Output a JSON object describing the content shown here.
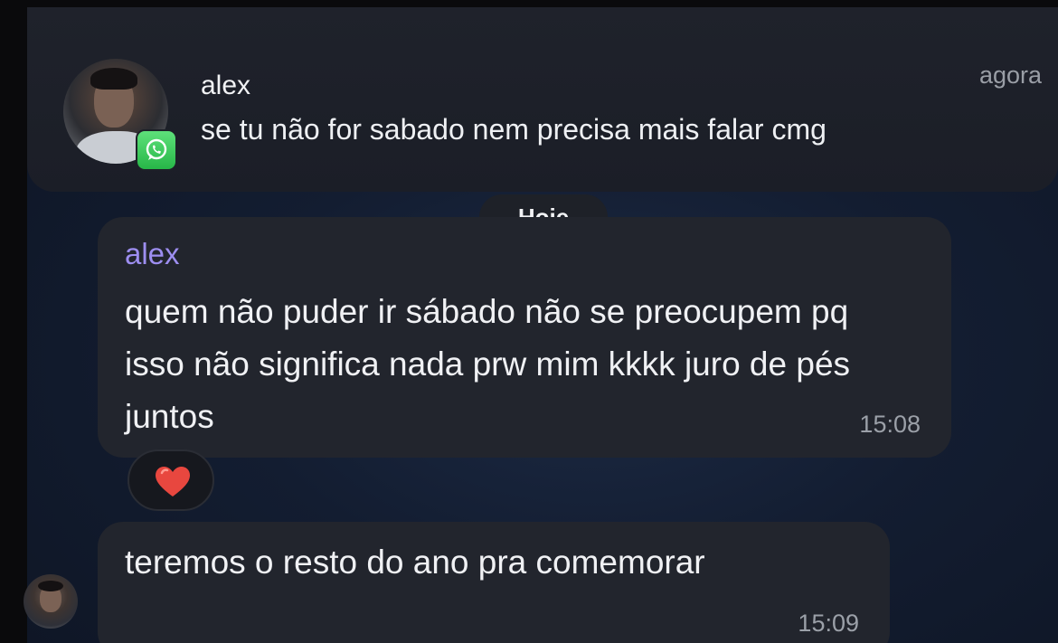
{
  "notification": {
    "sender": "alex",
    "time": "agora",
    "message": "se tu não for sabado nem precisa mais falar cmg",
    "app_icon": "whatsapp-icon",
    "avatar": "contact-avatar"
  },
  "chat": {
    "date_separator": "Hoje",
    "messages": [
      {
        "sender": "alex",
        "text": "quem não puder ir sábado não se preocupem pq isso não significa nada prw mim kkkk juro de pés juntos",
        "time": "15:08",
        "reaction": "red-heart-icon"
      },
      {
        "text": "teremos o resto do ano pra comemorar",
        "time": "15:09"
      }
    ]
  },
  "colors": {
    "background": "#131d31",
    "bubble": "#22252d",
    "sender_name": "#9d8ef0",
    "timestamp": "#9ba0a8",
    "whatsapp_green": "#27b748"
  }
}
